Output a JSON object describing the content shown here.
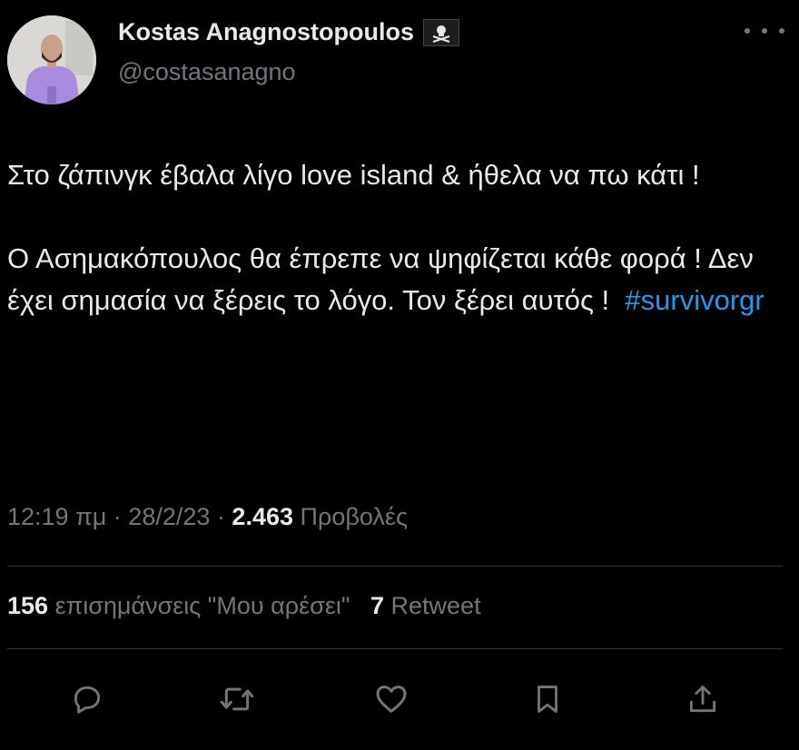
{
  "author": {
    "display_name": "Kostas Anagnostopoulos",
    "handle": "@costasanagno",
    "badge_icon": "pirate-flag-icon",
    "avatar": "profile-photo-man-in-purple-shirt"
  },
  "tweet": {
    "paragraphs": [
      {
        "text": "Στο ζάπινγκ έβαλα λίγο love island & ήθελα να πω κάτι !"
      },
      {
        "text": "Ο Ασημακόπουλος θα έπρεπε να ψηφίζεται κάθε φορά !  Δεν έχει σημασία να ξέρεις το λόγο. Τον ξέρει αυτός !",
        "hashtag": "#survivorgr"
      }
    ],
    "time": "12:19 πμ",
    "separator": "·",
    "date": "28/2/23",
    "views_count": "2.463",
    "views_label": "Προβολές"
  },
  "stats": {
    "likes_count": "156",
    "likes_label": "επισημάνσεις \"Μου αρέσει\"",
    "retweets_count": "7",
    "retweets_label": "Retweet"
  },
  "actions": [
    {
      "name": "reply",
      "icon": "reply-icon"
    },
    {
      "name": "retweet",
      "icon": "retweet-icon"
    },
    {
      "name": "like",
      "icon": "heart-icon"
    },
    {
      "name": "bookmark",
      "icon": "bookmark-icon"
    },
    {
      "name": "share",
      "icon": "share-icon"
    }
  ],
  "colors": {
    "background": "#000000",
    "text": "#e7e9ea",
    "secondary_text": "#71767b",
    "link": "#1d9bf0",
    "divider": "#2f3336"
  }
}
